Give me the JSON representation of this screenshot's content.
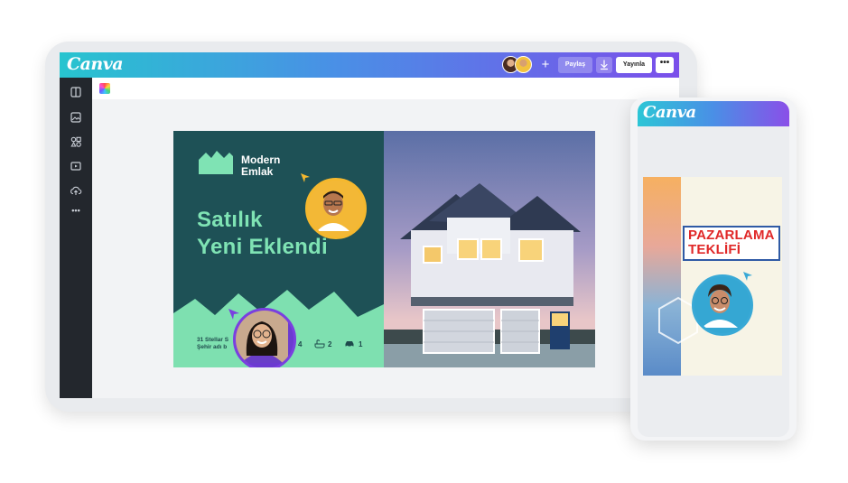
{
  "app": {
    "logo": "Canva",
    "share_label": "Paylaş",
    "publish_label": "Yayınla",
    "more_label": "•••",
    "add_collaborator_label": "+"
  },
  "sidebar": {
    "items": [
      "layout-icon",
      "photo-icon",
      "elements-icon",
      "video-icon",
      "upload-icon",
      "more-icon"
    ],
    "more_label": "•••"
  },
  "design": {
    "brand_line1": "Modern",
    "brand_line2": "Emlak",
    "headline_line1": "Satılık",
    "headline_line2": "Yeni Eklendi",
    "address_line1": "31 Stellar S",
    "address_line2": "Şehir adı b",
    "bedrooms": "4",
    "bathrooms": "2",
    "garage": "1",
    "colors": {
      "teal": "#1e5156",
      "mint": "#7fe3b4",
      "green_band": "#7ee0b0"
    }
  },
  "phone": {
    "logo": "Canva",
    "promo_line1": "PAZARLAMA",
    "promo_line2": "TEKLİFİ"
  },
  "colors": {
    "accent_start": "#27c4cf",
    "accent_end": "#7b4fea"
  }
}
